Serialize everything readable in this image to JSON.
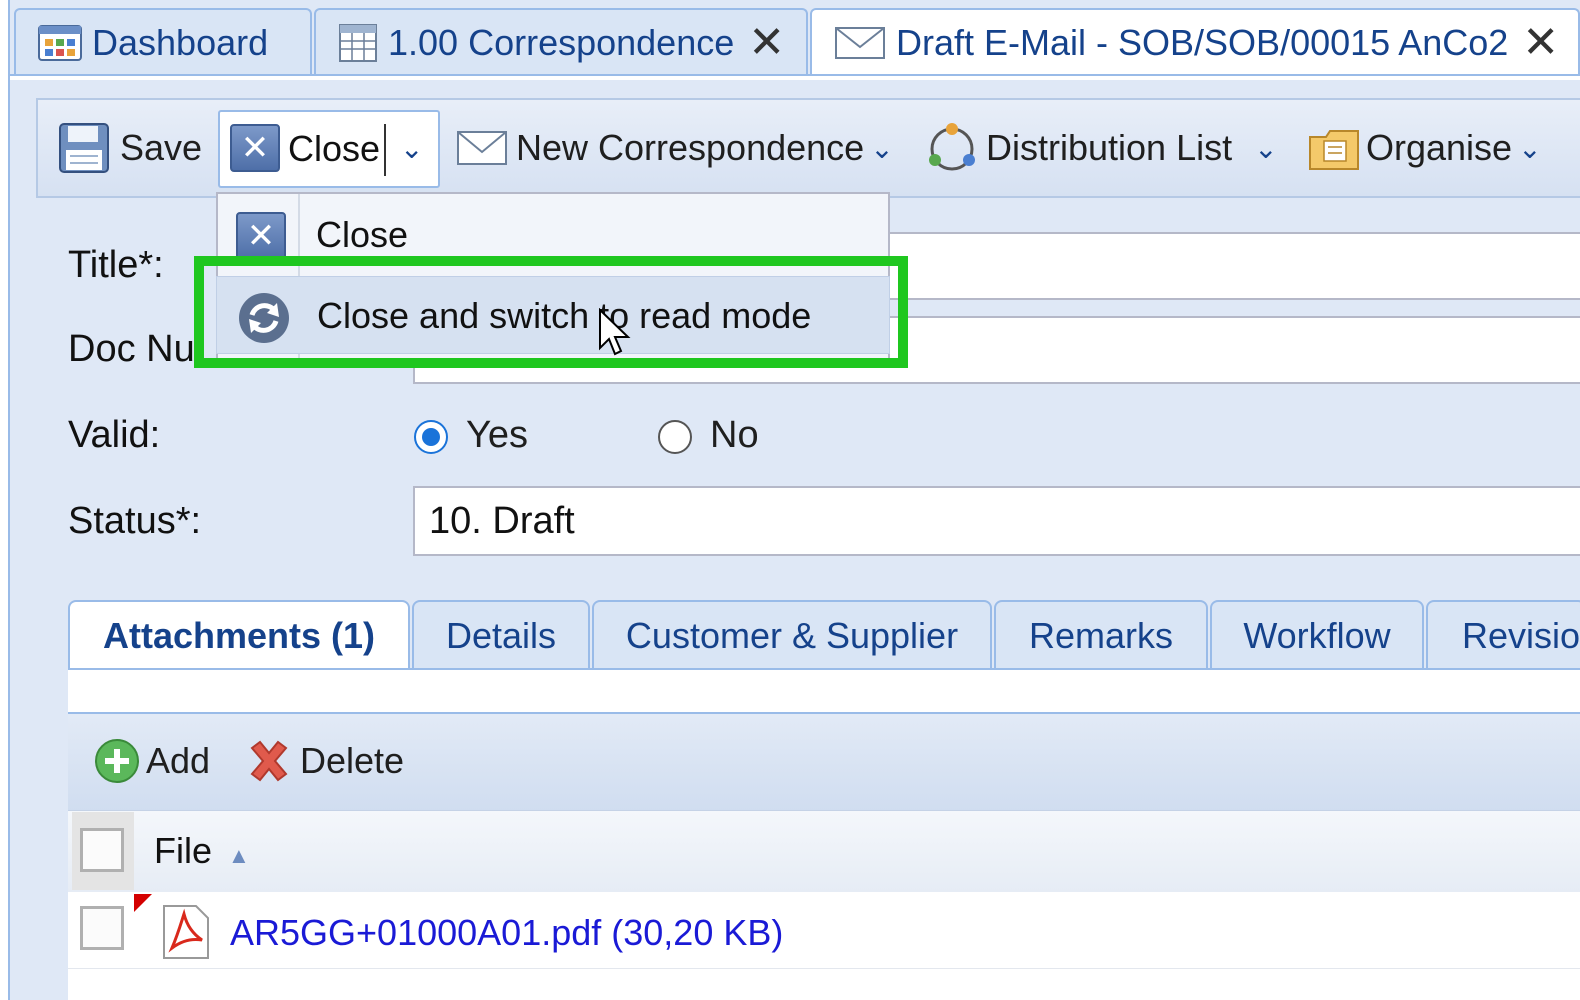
{
  "tabs": [
    {
      "label": "Dashboard",
      "icon": "dashboard-icon",
      "closable": false
    },
    {
      "label": "1.00 Correspondence",
      "icon": "table-icon",
      "closable": true
    },
    {
      "label": "Draft E-Mail - SOB/SOB/00015 AnCo2",
      "icon": "envelope-icon",
      "closable": true
    }
  ],
  "toolbar": {
    "save_label": "Save",
    "close_label": "Close",
    "new_correspondence_label": "New Correspondence",
    "distribution_list_label": "Distribution List",
    "organise_label": "Organise"
  },
  "close_menu": {
    "items": [
      {
        "label": "Close",
        "icon": "close-icon"
      },
      {
        "label": "Close and switch to read mode",
        "icon": "refresh-icon"
      }
    ]
  },
  "form": {
    "title_label": "Title*:",
    "title_value": "",
    "docnum_label": "Doc Nu",
    "docnum_value": "",
    "valid_label": "Valid:",
    "valid_yes": "Yes",
    "valid_no": "No",
    "valid_selected": "Yes",
    "status_label": "Status*:",
    "status_value": "10. Draft"
  },
  "subtabs": [
    {
      "label": "Attachments (1)",
      "active": true
    },
    {
      "label": "Details",
      "active": false
    },
    {
      "label": "Customer & Supplier",
      "active": false
    },
    {
      "label": "Remarks",
      "active": false
    },
    {
      "label": "Workflow",
      "active": false
    },
    {
      "label": "Revisio",
      "active": false
    }
  ],
  "attachments": {
    "add_label": "Add",
    "delete_label": "Delete",
    "column_file": "File",
    "sort_indicator": "▲",
    "rows": [
      {
        "file": "AR5GG+01000A01.pdf (30,20 KB)"
      }
    ]
  },
  "colors": {
    "highlight": "#1fc71f",
    "link": "#1a1ad6",
    "tab_text": "#15428b"
  }
}
